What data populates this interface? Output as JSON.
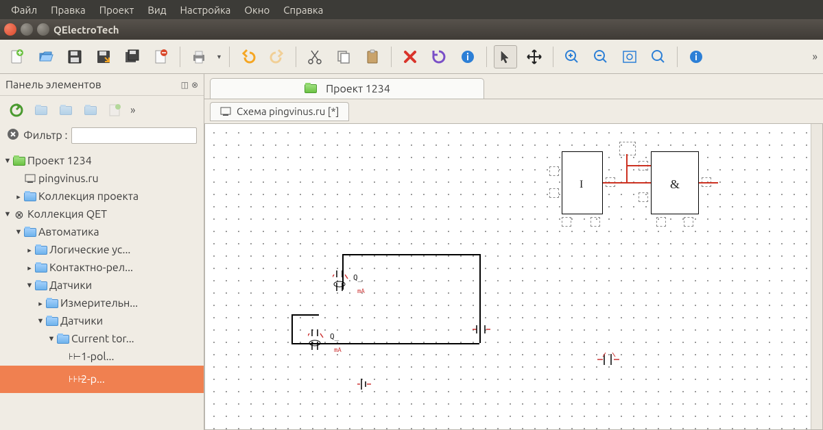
{
  "menu": {
    "file": "Файл",
    "edit": "Правка",
    "project": "Проект",
    "view": "Вид",
    "settings": "Настройка",
    "window": "Окно",
    "help": "Справка"
  },
  "app_title": "QElectroTech",
  "panel_title": "Панель элементов",
  "filter_label": "Фильтр :",
  "filter_value": "",
  "tree": {
    "project": "Проект 1234",
    "pingvinus": "pingvinus.ru",
    "proj_collection": "Коллекция проекта",
    "qet_collection": "Коллекция QET",
    "automation": "Автоматика",
    "logic": "Логические ус...",
    "contact": "Контактно-рел...",
    "sensors": "Датчики",
    "measure": "Измерительн...",
    "sensors2": "Датчики",
    "current": "Current tor...",
    "item1": "1-pol...",
    "item2": "2-p..."
  },
  "doctab": "Проект 1234",
  "subtab": "Схема pingvinus.ru [*]",
  "schematic": {
    "block1_label": "I",
    "block2_label": "&",
    "q1": "Q_",
    "q2": "Q_",
    "ma": "mA"
  }
}
